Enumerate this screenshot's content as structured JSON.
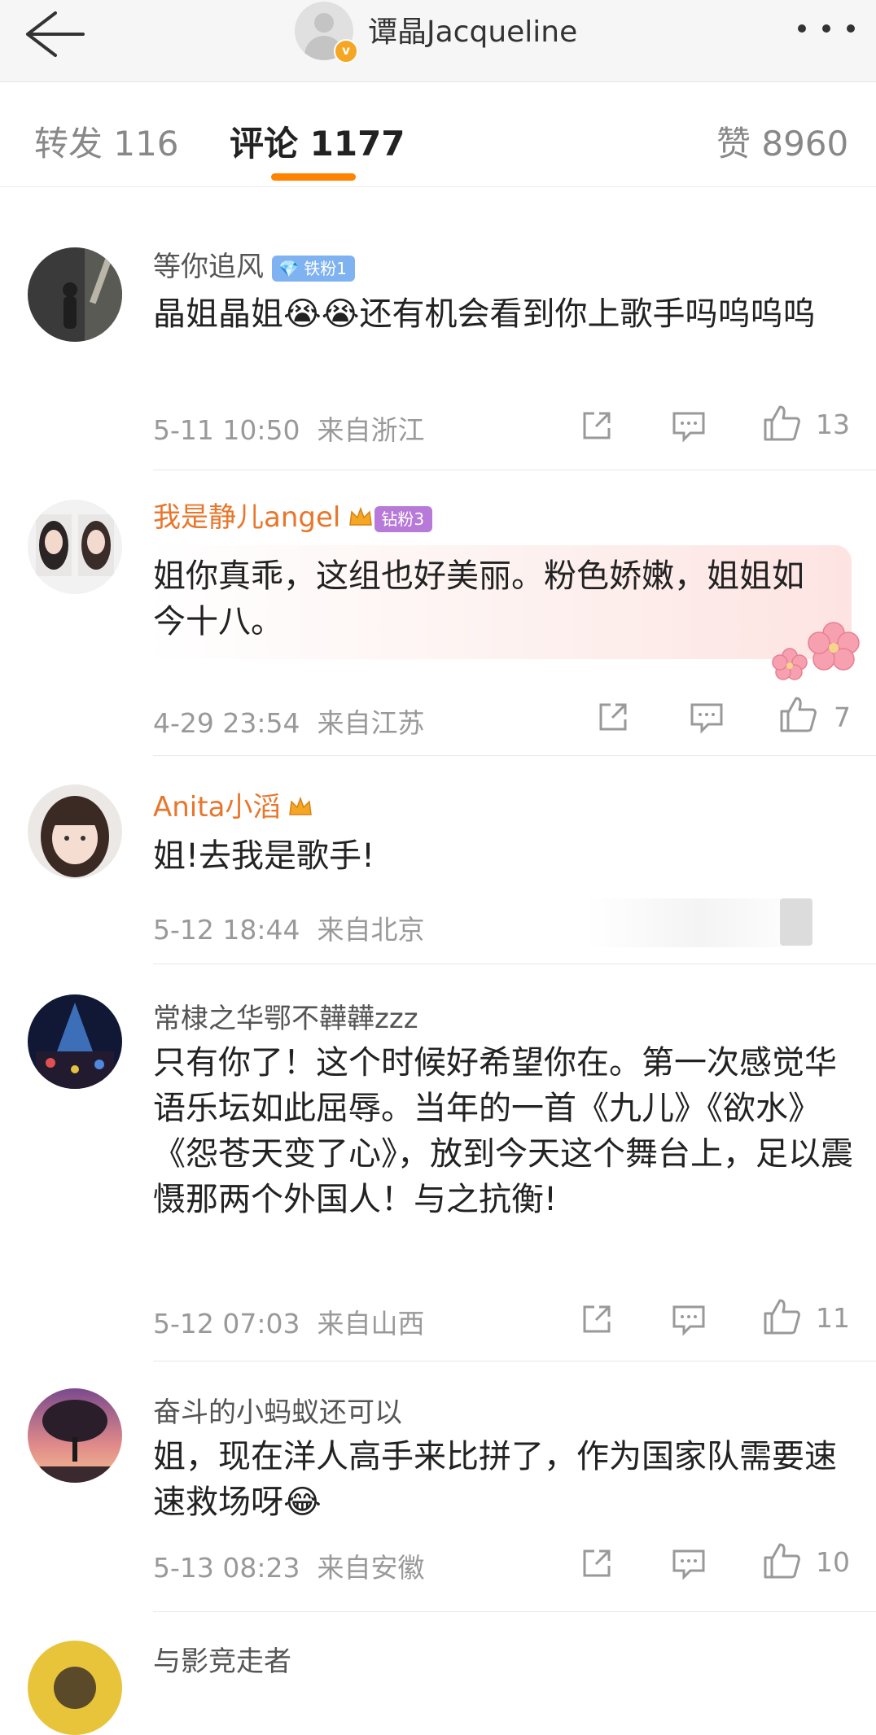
{
  "header": {
    "title": "谭晶Jacqueline",
    "verified_badge": "v"
  },
  "tabs": [
    {
      "label": "转发 116"
    },
    {
      "label": "评论 1177"
    },
    {
      "label": "赞 8960"
    }
  ],
  "colors": {
    "accent": "#ff8200",
    "vip_name": "#e8762b",
    "iron_badge": "#7fb2f0",
    "diamond_badge": "#b77ad8"
  },
  "comments": [
    {
      "name": "等你追风",
      "badge": "铁粉1",
      "text_a": "晶姐晶姐",
      "text_b": "还有机会看到你上歌手吗呜呜呜",
      "time": "5-11 10:50",
      "location": "来自浙江",
      "likes": "13"
    },
    {
      "name": "我是静儿angel",
      "badge": "钻粉3",
      "text": "姐你真乖，这组也好美丽。粉色娇嫩，姐姐如今十八。",
      "time": "4-29 23:54",
      "location": "来自江苏",
      "likes": "7"
    },
    {
      "name": "Anita小滔",
      "text": "姐!去我是歌手!",
      "time": "5-12 18:44",
      "location": "来自北京"
    },
    {
      "name": "常棣之华鄂不韡韡zzz",
      "text": "只有你了！这个时候好希望你在。第一次感觉华语乐坛如此屈辱。当年的一首《九儿》《欲水》《怨苍天变了心》，放到今天这个舞台上，足以震慑那两个外国人！与之抗衡!",
      "time": "5-12 07:03",
      "location": "来自山西",
      "likes": "11"
    },
    {
      "name": "奋斗的小蚂蚁还可以",
      "text": "姐，现在洋人高手来比拼了，作为国家队需要速速救场呀",
      "time": "5-13 08:23",
      "location": "来自安徽",
      "likes": "10"
    },
    {
      "name": "与影竞走者"
    }
  ]
}
